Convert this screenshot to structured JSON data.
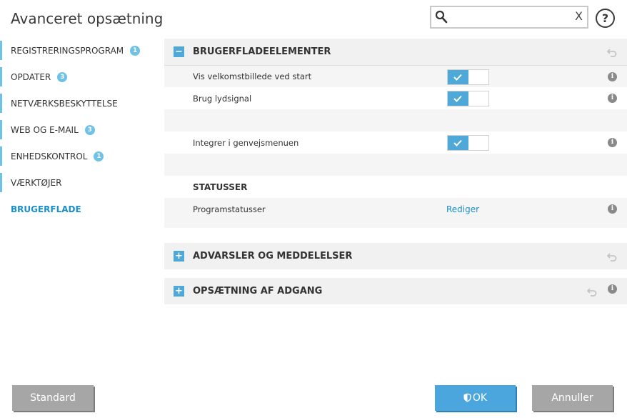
{
  "window": {
    "title": "Avanceret opsætning"
  },
  "search": {
    "value": "",
    "placeholder": "",
    "clear_label": "X"
  },
  "help": {
    "label": "?"
  },
  "sidebar": {
    "items": [
      {
        "label": "REGISTRERINGSPROGRAM",
        "badge": "1"
      },
      {
        "label": "OPDATER",
        "badge": "3"
      },
      {
        "label": "NETVÆRKSBESKYTTELSE",
        "badge": ""
      },
      {
        "label": "WEB OG E-MAIL",
        "badge": "3"
      },
      {
        "label": "ENHEDSKONTROL",
        "badge": "1"
      },
      {
        "label": "VÆRKTØJER",
        "badge": ""
      },
      {
        "label": "BRUGERFLADE",
        "badge": "",
        "active": true
      }
    ]
  },
  "main": {
    "sections": [
      {
        "title": "BRUGERFLADEELEMENTER",
        "expanded": true,
        "expand_symbol": "−",
        "rows": [
          {
            "label": "Vis velkomstbillede ved start",
            "enabled": true
          },
          {
            "label": "Brug lydsignal",
            "enabled": true
          },
          {
            "label": "Integrer i genvejsmenuen",
            "enabled": true
          }
        ],
        "subsection": "STATUSSER",
        "status_row": {
          "label": "Programstatusser",
          "link": "Rediger"
        }
      },
      {
        "title": "ADVARSLER OG MEDDELELSER",
        "expanded": false,
        "expand_symbol": "+"
      },
      {
        "title": "OPSÆTNING AF ADGANG",
        "expanded": false,
        "expand_symbol": "+"
      }
    ],
    "info_symbol": "i"
  },
  "footer": {
    "default_label": "Standard",
    "ok_label": "OK",
    "cancel_label": "Annuller"
  },
  "colors": {
    "accent": "#4ea8d8",
    "link": "#1a8fc9",
    "badge": "#6fc2e6",
    "button_gray": "#a6a6a6"
  }
}
